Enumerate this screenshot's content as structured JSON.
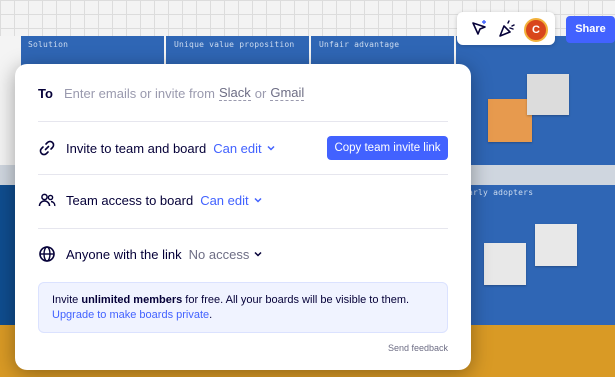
{
  "board": {
    "columns": [
      "Solution",
      "Unique value proposition",
      "Unfair advantage",
      "Early adopters"
    ],
    "column_4_label": "arly adopters"
  },
  "toolbar": {
    "icons": [
      "cursor-reaction-icon",
      "celebrate-icon"
    ],
    "avatar_initial": "C",
    "share_label": "Share"
  },
  "modal": {
    "to_label": "To",
    "to_placeholder_prefix": "Enter emails or invite from",
    "to_slack": "Slack",
    "to_or": "or",
    "to_gmail": "Gmail",
    "invite_label": "Invite to team and board",
    "invite_permission": "Can edit",
    "copy_button": "Copy team invite link",
    "team_label": "Team access to board",
    "team_permission": "Can edit",
    "anyone_label": "Anyone with the link",
    "anyone_permission": "No access",
    "banner_prefix": "Invite",
    "banner_bold": "unlimited members",
    "banner_suffix": "for free. All your boards will be visible to them.",
    "banner_link": "Upgrade to make boards private",
    "banner_link_suffix": ".",
    "feedback": "Send feedback"
  },
  "colors": {
    "accent": "#4262ff",
    "text": "#050038",
    "board_blue": "#2f66b5",
    "board_dark_blue": "#0f4d8f",
    "sticky_orange": "#e79a4e"
  }
}
